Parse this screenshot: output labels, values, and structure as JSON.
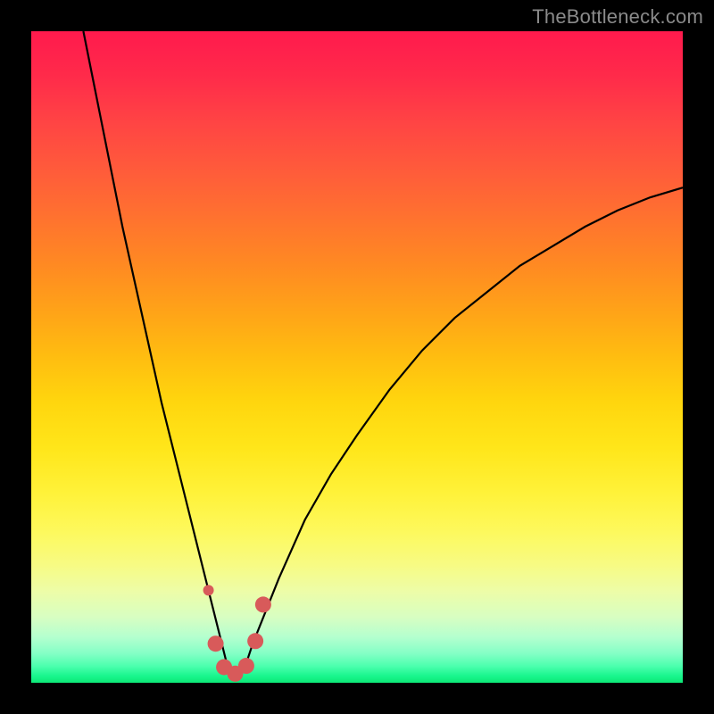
{
  "watermark": "TheBottleneck.com",
  "colors": {
    "page_bg": "#000000",
    "watermark": "#8a8a8a",
    "curve_stroke": "#000000",
    "marker_stroke": "#d85a5a",
    "marker_fill": "#d85a5a"
  },
  "chart_data": {
    "type": "line",
    "title": "",
    "xlabel": "",
    "ylabel": "",
    "xlim": [
      0,
      100
    ],
    "ylim": [
      0,
      100
    ],
    "grid": false,
    "legend": false,
    "note": "Background vertical gradient encodes bottleneck severity from red (high) at top to green (low) at bottom; the black V-curve shows severity vs. an unlabeled x parameter with a minimum near x≈30.",
    "series": [
      {
        "name": "bottleneck-curve",
        "x": [
          8,
          10,
          12,
          14,
          16,
          18,
          20,
          22,
          24,
          26,
          27,
          28,
          29,
          30,
          31,
          32,
          33,
          34,
          36,
          38,
          42,
          46,
          50,
          55,
          60,
          65,
          70,
          75,
          80,
          85,
          90,
          95,
          100
        ],
        "y": [
          100,
          90,
          80,
          70,
          61,
          52,
          43,
          35,
          27,
          19,
          15,
          11,
          7,
          3,
          1,
          1,
          3,
          6,
          11,
          16,
          25,
          32,
          38,
          45,
          51,
          56,
          60,
          64,
          67,
          70,
          72.5,
          74.5,
          76
        ]
      }
    ],
    "markers": {
      "name": "highlight-dots",
      "x": [
        27.2,
        28.3,
        29.6,
        31.3,
        33.0,
        34.4,
        35.6
      ],
      "y": [
        14.2,
        6.0,
        2.4,
        1.4,
        2.6,
        6.4,
        12.0
      ],
      "radius": [
        6,
        9,
        9,
        9,
        9,
        9,
        9
      ]
    }
  }
}
